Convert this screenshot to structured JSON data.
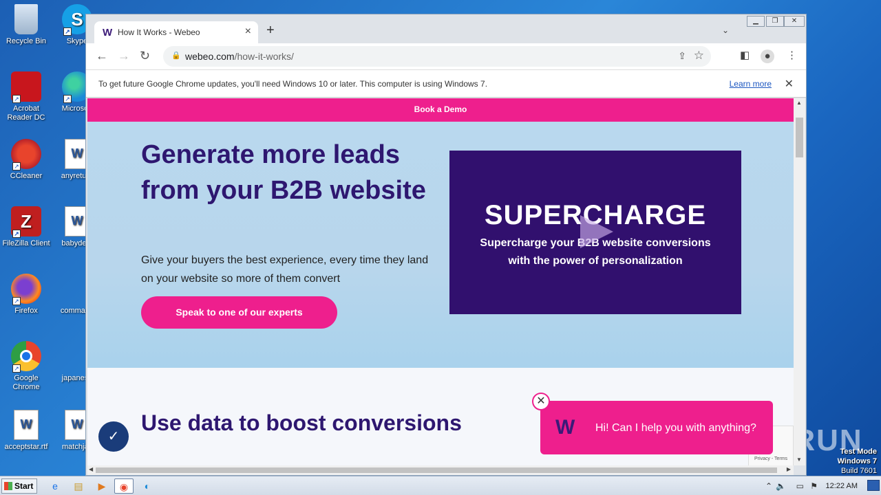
{
  "desktop": {
    "icons": [
      {
        "label": "Recycle Bin",
        "icon": "recycle-bin-icon"
      },
      {
        "label": "Skype",
        "icon": "skype-icon"
      },
      {
        "label": "Acrobat Reader DC",
        "icon": "acrobat-icon"
      },
      {
        "label": "Microsoft",
        "icon": "edge-icon"
      },
      {
        "label": "CCleaner",
        "icon": "ccleaner-icon"
      },
      {
        "label": "anyreturn",
        "icon": "word-doc-icon"
      },
      {
        "label": "FileZilla Client",
        "icon": "filezilla-icon"
      },
      {
        "label": "babydeat",
        "icon": "word-doc-icon"
      },
      {
        "label": "Firefox",
        "icon": "firefox-icon"
      },
      {
        "label": "command",
        "icon": "blank-file-icon"
      },
      {
        "label": "Google Chrome",
        "icon": "chrome-icon"
      },
      {
        "label": "japanese",
        "icon": "blank-file-icon"
      },
      {
        "label": "acceptstar.rtf",
        "icon": "word-doc-icon"
      },
      {
        "label": "matchjac",
        "icon": "word-doc-icon"
      }
    ],
    "watermark": {
      "line1": "Test Mode",
      "line2": "Windows 7",
      "line3": "Build 7601"
    },
    "anyrun": "ANY RUN"
  },
  "browser": {
    "tab_title": "How It Works - Webeo",
    "tab_favicon": "W",
    "url_host": "webeo.com",
    "url_path": "/how-it-works/",
    "infobar_message": "To get future Google Chrome updates, you'll need Windows 10 or later. This computer is using Windows 7.",
    "infobar_link": "Learn more"
  },
  "page": {
    "demo_bar": "Book a Demo",
    "hero_title": "Generate more leads from your B2B website",
    "hero_text": "Give your buyers the best experience, every time they land on your website so more of them convert",
    "cta": "Speak to one of our experts",
    "video_big": "SUPERCHARGE",
    "video_sub_line1": "Supercharge your B2B website conversions",
    "video_sub_line2": "with the power of personalization",
    "section2_title": "Use data to boost conversions",
    "chat_text": "Hi! Can I help you with anything?",
    "recaptcha": "Privacy - Terms"
  },
  "taskbar": {
    "start": "Start",
    "clock": "12:22 AM"
  },
  "colors": {
    "accent_pink": "#ee1f8d",
    "brand_purple": "#2e1770",
    "hero_bg": "#b9d8ee"
  }
}
